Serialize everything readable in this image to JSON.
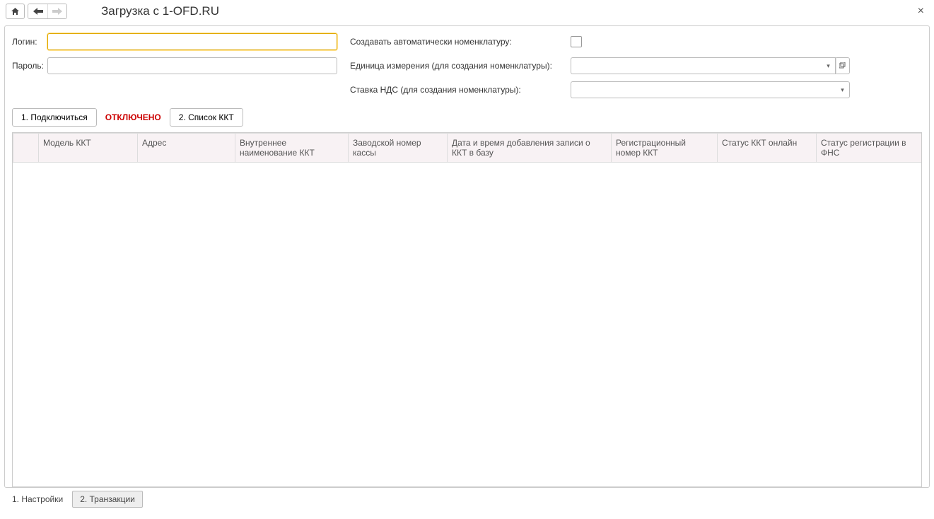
{
  "titlebar": {
    "title": "Загрузка с 1-OFD.RU"
  },
  "form": {
    "login_label": "Логин:",
    "login_value": "",
    "password_label": "Пароль:",
    "password_value": "",
    "auto_create_label": "Создавать автоматически номенклатуру:",
    "auto_create_checked": false,
    "unit_label": "Единица измерения (для создания номенклатуры):",
    "unit_value": "",
    "vat_label": "Ставка НДС (для создания номенклатуры):",
    "vat_value": ""
  },
  "actions": {
    "connect_label": "1. Подключиться",
    "status_label": "ОТКЛЮЧЕНО",
    "kkt_list_label": "2. Список ККТ"
  },
  "table": {
    "columns": [
      "",
      "Модель ККТ",
      "Адрес",
      "Внутреннее наименование ККТ",
      "Заводской номер кассы",
      "Дата и время добавления записи о ККТ в базу",
      "Регистрационный номер ККТ",
      "Статус ККТ онлайн",
      "Статус регистрации в ФНС"
    ],
    "rows": []
  },
  "tabs": {
    "settings_label": "1. Настройки",
    "transactions_label": "2. Транзакции",
    "active": "transactions"
  }
}
